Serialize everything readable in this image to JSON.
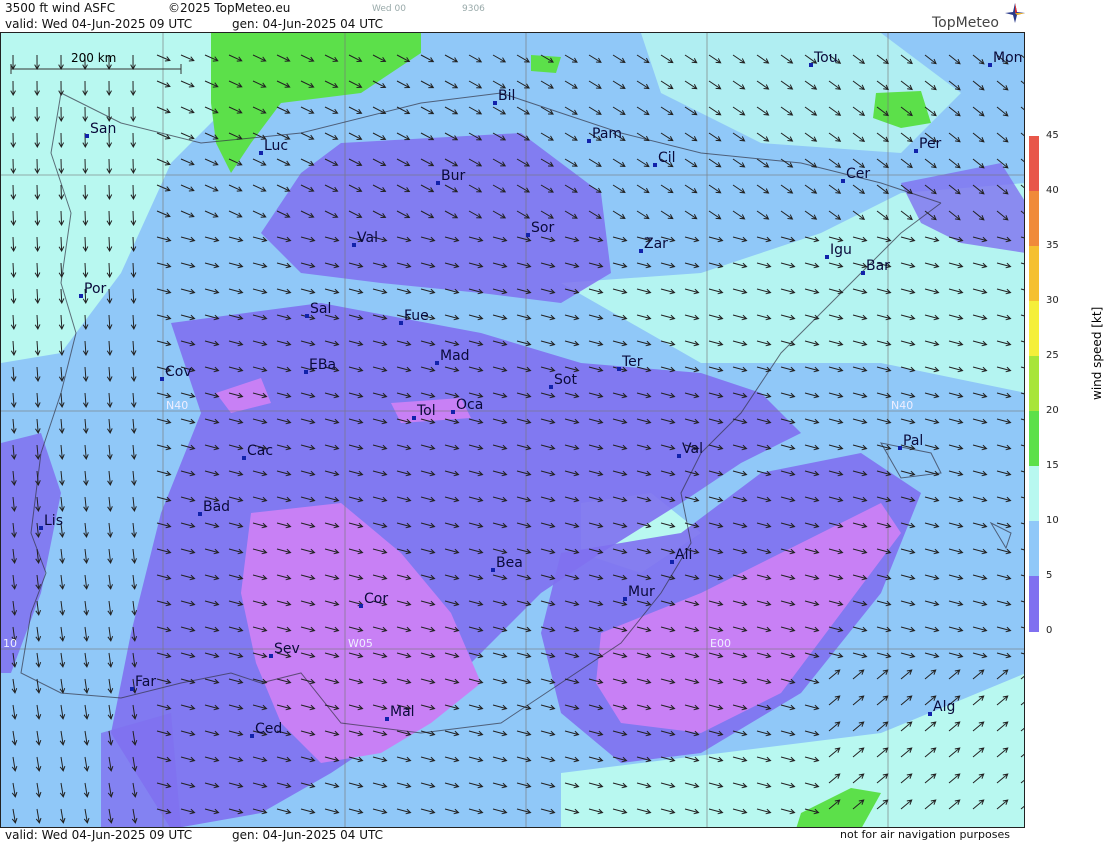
{
  "header": {
    "product": "3500 ft wind ASFC",
    "copyright": "©2025 TopMeteo.eu",
    "run_small": "Wed 00",
    "code_small": "9306",
    "valid": "valid:  Wed  04-Jun-2025  09 UTC",
    "gen": "gen: 04-Jun-2025 04 UTC"
  },
  "logo": "TopMeteo",
  "scale_label": "200 km",
  "colorbar": {
    "label": "wind speed  [kt]",
    "ticks": [
      "45",
      "40",
      "35",
      "30",
      "25",
      "20",
      "15",
      "10",
      "5",
      "0"
    ],
    "colors": [
      "#e8574a",
      "#f08a3a",
      "#f5c030",
      "#f5ef3a",
      "#a8e53a",
      "#5ce04a",
      "#b8f8f0",
      "#90c8f8",
      "#8070f0",
      "#c880f5"
    ]
  },
  "grid_labels": {
    "n40_left": "N40",
    "n40_right": "N40",
    "w05": "W05",
    "e00": "E00",
    "w10": "10"
  },
  "cities": [
    {
      "name": "San"
    },
    {
      "name": "Luc"
    },
    {
      "name": "Bil"
    },
    {
      "name": "Pam"
    },
    {
      "name": "Cil"
    },
    {
      "name": "Tou"
    },
    {
      "name": "Mon"
    },
    {
      "name": "Per"
    },
    {
      "name": "Cer"
    },
    {
      "name": "Bur"
    },
    {
      "name": "Sor"
    },
    {
      "name": "Zar"
    },
    {
      "name": "Igu"
    },
    {
      "name": "Bar"
    },
    {
      "name": "Val"
    },
    {
      "name": "Por"
    },
    {
      "name": "Sal"
    },
    {
      "name": "Fue"
    },
    {
      "name": "Mad"
    },
    {
      "name": "EBa"
    },
    {
      "name": "Cov"
    },
    {
      "name": "Ter"
    },
    {
      "name": "Sot"
    },
    {
      "name": "Tol"
    },
    {
      "name": "Oca"
    },
    {
      "name": "Val"
    },
    {
      "name": "Pal"
    },
    {
      "name": "Cac"
    },
    {
      "name": "Bad"
    },
    {
      "name": "Lis"
    },
    {
      "name": "Ali"
    },
    {
      "name": "Bea"
    },
    {
      "name": "Mur"
    },
    {
      "name": "Cor"
    },
    {
      "name": "Sev"
    },
    {
      "name": "Far"
    },
    {
      "name": "Mal"
    },
    {
      "name": "Ced"
    },
    {
      "name": "Alg"
    }
  ],
  "footer": {
    "valid": "valid:  Wed  04-Jun-2025  09 UTC",
    "gen": "gen: 04-Jun-2025 04 UTC",
    "note": "not for air navigation purposes"
  }
}
